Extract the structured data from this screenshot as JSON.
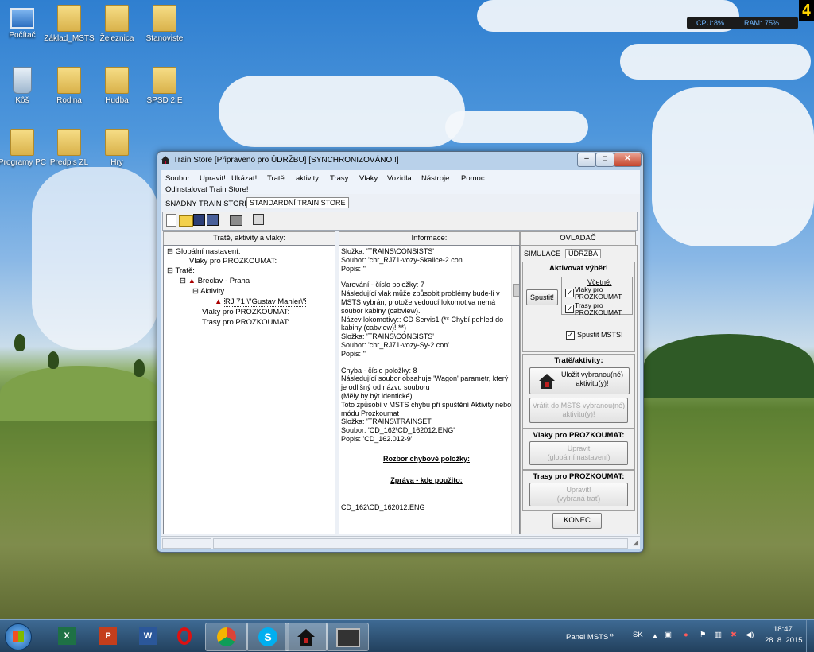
{
  "desktop": {
    "icons": [
      {
        "label": "Počítač",
        "icon": "computer-icon"
      },
      {
        "label": "Základ_MSTS",
        "icon": "folder-icon"
      },
      {
        "label": "Železnica",
        "icon": "folder-icon"
      },
      {
        "label": "Stanoviste",
        "icon": "folder-icon"
      },
      {
        "label": "Kôš",
        "icon": "recycle-bin-icon"
      },
      {
        "label": "Rodina",
        "icon": "folder-icon"
      },
      {
        "label": "Hudba",
        "icon": "folder-icon"
      },
      {
        "label": "SPSD 2.E",
        "icon": "folder-icon"
      },
      {
        "label": "Programy PC",
        "icon": "folder-icon"
      },
      {
        "label": "Predpis ZL",
        "icon": "folder-icon"
      },
      {
        "label": "Hry",
        "icon": "folder-icon"
      }
    ],
    "widget": {
      "cpu_label": "CPU:",
      "cpu_value": "8%",
      "ram_label": "RAM:",
      "ram_value": "75%",
      "badge": "4"
    }
  },
  "window": {
    "title": "Train Store [Připraveno pro ÚDRŽBU] [SYNCHRONIZOVÁNO !]",
    "menu": [
      "Soubor:",
      "Upravit!",
      "Ukázat!",
      "Tratě:",
      "aktivity:",
      "Trasy:",
      "Vlaky:",
      "Vozidla:",
      "Nástroje:",
      "Pomoc:"
    ],
    "menu2": "Odinstalovat Train Store!",
    "tabs": [
      "SNADNÝ TRAIN STORE",
      "STANDARDNÍ TRAIN STORE"
    ],
    "left_panel": {
      "header": "Tratě, aktivity a vlaky:",
      "tree": [
        "Globální nastavení:",
        "Vlaky pro PROZKOUMAT:",
        "Tratě:",
        "Breclav - Praha",
        "Aktivity",
        "RJ 71 \\\"Gustav Mahler\\\"",
        "Vlaky pro PROZKOUMAT:",
        "Trasy pro PROZKOUMAT:"
      ]
    },
    "info_panel": {
      "header": "Informace:",
      "lines": [
        "Složka: 'TRAINS\\CONSISTS'",
        "Soubor: 'chr_RJ71-vozy-Skalice-2.con'",
        "Popis: ''",
        "",
        "Varování - číslo položky: 7",
        "Následující vlak může způsobit problémy bude-li v MSTS vybrán, protože vedoucí lokomotiva nemá soubor kabiny (cabview).",
        "Název lokomotivy:: CD Servis1 (** Chybí pohled do kabiny (cabview)! **)",
        "Složka: 'TRAINS\\CONSISTS'",
        "Soubor: 'chr_RJ71-vozy-Sy-2.con'",
        "Popis: ''",
        "",
        "Chyba - číslo položky: 8",
        "Následující soubor obsahuje 'Wagon' parametr, který je odlišný od názvu souboru",
        "(Měly by být identické)",
        "Toto způsobí v MSTS chybu při spuštění Aktivity nebo módu Prozkoumat",
        "Složka: 'TRAINS\\TRAINSET'",
        "Soubor: 'CD_162\\CD_162012.ENG'",
        "Popis: 'CD_162.012-9'"
      ],
      "link1": "Rozbor chybové položky:",
      "link2": "Zpráva - kde použito:",
      "footer": "CD_162\\CD_162012.ENG"
    },
    "right_panel": {
      "header": "OVLADAČ",
      "tabs": [
        "SIMULACE",
        "ÚDRŽBA"
      ],
      "activate_title": "Aktivovat výběr!",
      "run_button": "Spustit!",
      "includes_label": "Včetně:",
      "chk1": "Vlaky pro PROZKOUMAT:",
      "chk2": "Trasy pro PROZKOUMAT:",
      "chk3": "Spustit MSTS!",
      "routes_title": "Tratě/aktivity:",
      "save_button": "Uložit vybranou(né) aktivitu(y)!",
      "restore_button": "Vrátit do MSTS vybranou(né) aktivitu(y)!",
      "trains_title": "Vlaky pro PROZKOUMAT:",
      "edit_global_button_line1": "Upravit",
      "edit_global_button_line2": "(globální nastavení)",
      "paths_title": "Trasy pro PROZKOUMAT:",
      "edit_route_button_line1": "Upravit!",
      "edit_route_button_line2": "(vybraná trať)",
      "end_button": "KONEC"
    }
  },
  "taskbar": {
    "panel_label": "Panel MSTS",
    "lang": "SK",
    "time": "18:47",
    "date": "28. 8. 2015"
  },
  "colors": {
    "accent": "#1f5fa8",
    "window_frame": "#b9d1ea"
  }
}
